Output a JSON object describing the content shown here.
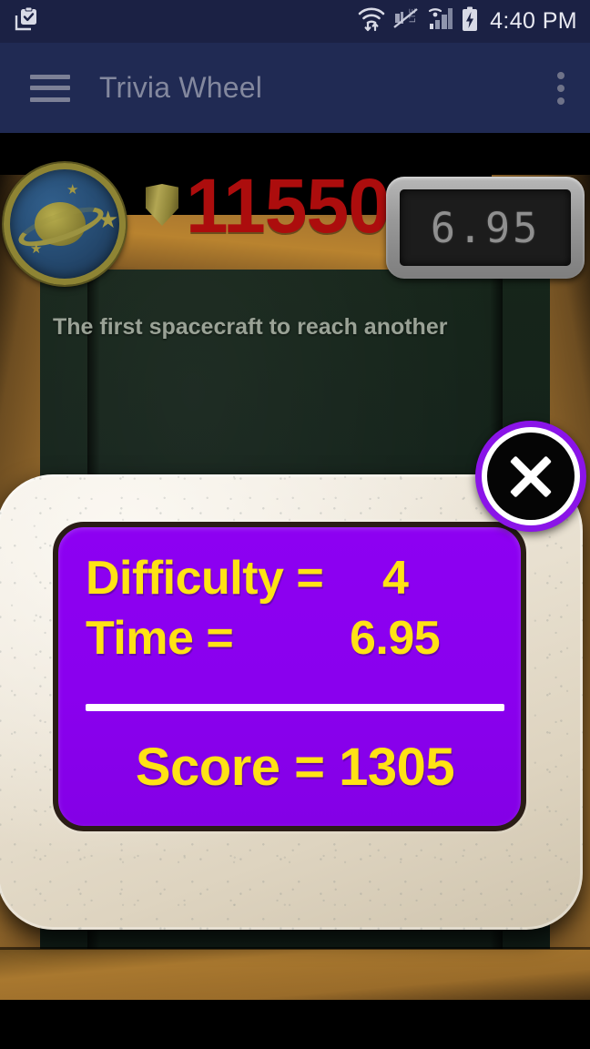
{
  "status_bar": {
    "time": "4:40 PM",
    "icons": [
      "clipboard-check-icon",
      "wifi-icon",
      "lte-muted-icon",
      "signal-icon",
      "battery-charging-icon"
    ]
  },
  "app_bar": {
    "title": "Trivia Wheel",
    "menu_icon": "hamburger-menu-icon",
    "overflow_icon": "overflow-menu-icon"
  },
  "hud": {
    "badge_icon": "planet-saturn-badge-icon",
    "shield_icon": "shield-icon",
    "total_score": "11550",
    "timer_value": "6.95"
  },
  "board": {
    "question": "The first spacecraft to reach another"
  },
  "dialog": {
    "difficulty_label": "Difficulty =",
    "difficulty_value": "4",
    "time_label": "Time =",
    "time_value": "6.95",
    "score_text": "Score = 1305",
    "close_icon": "close-x-icon"
  },
  "colors": {
    "status_bar_bg": "#1b2144",
    "app_bar_bg": "#202a53",
    "panel_purple": "#8d00f2",
    "text_yellow": "#ffe215",
    "score_red": "#ac0d0d",
    "frame_cream": "#e8e0d0",
    "board_green": "#13211a",
    "wood_brown": "#a8762f",
    "close_ring_purple": "#8a14e8"
  }
}
